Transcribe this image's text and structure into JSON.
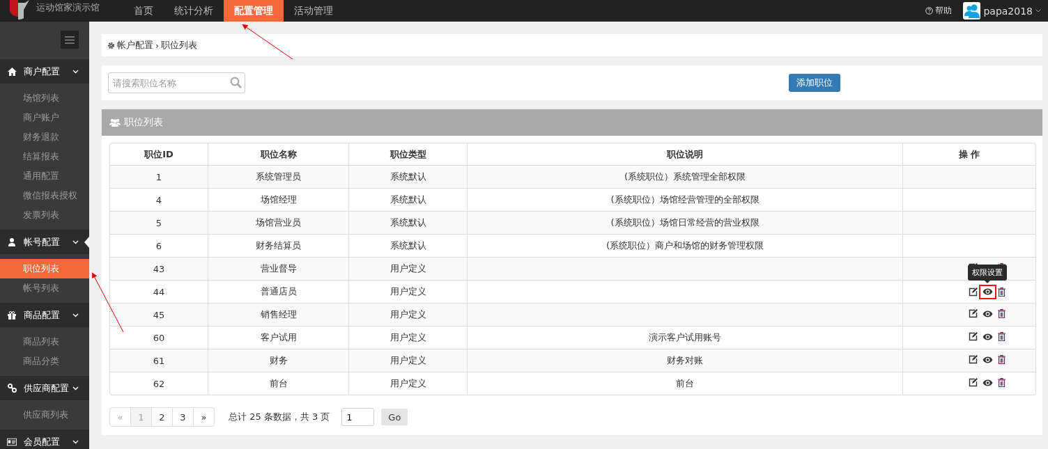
{
  "app": {
    "title": "运动馆家演示馆"
  },
  "nav": [
    {
      "label": "首页",
      "selected": false
    },
    {
      "label": "统计分析",
      "selected": false
    },
    {
      "label": "配置管理",
      "selected": true
    },
    {
      "label": "活动管理",
      "selected": false
    }
  ],
  "header_right": {
    "help": "帮助",
    "user": "papa2018"
  },
  "sidebar": {
    "groups": [
      {
        "label": "商户配置",
        "current": false,
        "items": [
          {
            "label": "场馆列表",
            "selected": false
          },
          {
            "label": "商户账户",
            "selected": false
          },
          {
            "label": "财务退款",
            "selected": false
          },
          {
            "label": "结算报表",
            "selected": false
          },
          {
            "label": "通用配置",
            "selected": false
          },
          {
            "label": "微信报表授权",
            "selected": false
          },
          {
            "label": "发票列表",
            "selected": false
          }
        ]
      },
      {
        "label": "帐号配置",
        "current": true,
        "items": [
          {
            "label": "职位列表",
            "selected": true
          },
          {
            "label": "帐号列表",
            "selected": false
          }
        ]
      },
      {
        "label": "商品配置",
        "current": false,
        "items": [
          {
            "label": "商品列表",
            "selected": false
          },
          {
            "label": "商品分类",
            "selected": false
          }
        ]
      },
      {
        "label": "供应商配置",
        "current": false,
        "items": [
          {
            "label": "供应商列表",
            "selected": false
          }
        ]
      },
      {
        "label": "会员配置",
        "current": false
      }
    ]
  },
  "breadcrumb": {
    "parent": "帐户配置",
    "separator": "›",
    "current": "职位列表"
  },
  "search": {
    "placeholder": "请搜索职位名称"
  },
  "add_button": "添加职位",
  "panel_title": "职位列表",
  "table": {
    "columns": [
      "职位ID",
      "职位名称",
      "职位类型",
      "职位说明",
      "操  作"
    ],
    "rows": [
      {
        "cells": [
          "1",
          "系统管理员",
          "系统默认",
          "(系统职位）系统管理全部权限"
        ],
        "actions": false
      },
      {
        "cells": [
          "4",
          "场馆经理",
          "系统默认",
          "(系统职位）场馆经营管理的全部权限"
        ],
        "actions": false
      },
      {
        "cells": [
          "5",
          "场馆营业员",
          "系统默认",
          "(系统职位）场馆日常经营的营业权限"
        ],
        "actions": false
      },
      {
        "cells": [
          "6",
          "财务结算员",
          "系统默认",
          "(系统职位）商户和场馆的财务管理权限"
        ],
        "actions": false
      },
      {
        "cells": [
          "43",
          "营业督导",
          "用户定义",
          ""
        ],
        "actions": true,
        "highlighted": false
      },
      {
        "cells": [
          "44",
          "普通店员",
          "用户定义",
          ""
        ],
        "actions": true,
        "highlighted": true
      },
      {
        "cells": [
          "45",
          "销售经理",
          "用户定义",
          ""
        ],
        "actions": true,
        "highlighted": false
      },
      {
        "cells": [
          "60",
          "客户试用",
          "用户定义",
          "演示客户试用账号"
        ],
        "actions": true,
        "highlighted": false
      },
      {
        "cells": [
          "61",
          "财务",
          "用户定义",
          "财务对账"
        ],
        "actions": true,
        "highlighted": false
      },
      {
        "cells": [
          "62",
          "前台",
          "用户定义",
          "前台"
        ],
        "actions": true,
        "highlighted": false
      }
    ]
  },
  "tooltip": "权限设置",
  "pagination": {
    "prev": {
      "label": "«",
      "disabled": true
    },
    "pages": [
      {
        "label": "1",
        "selected": true
      },
      {
        "label": "2",
        "selected": false
      },
      {
        "label": "3",
        "selected": false
      }
    ],
    "next": {
      "label": "»",
      "disabled": false
    },
    "summary": "总计 25 条数据，共 3 页",
    "page_input": "1",
    "go": "Go"
  }
}
